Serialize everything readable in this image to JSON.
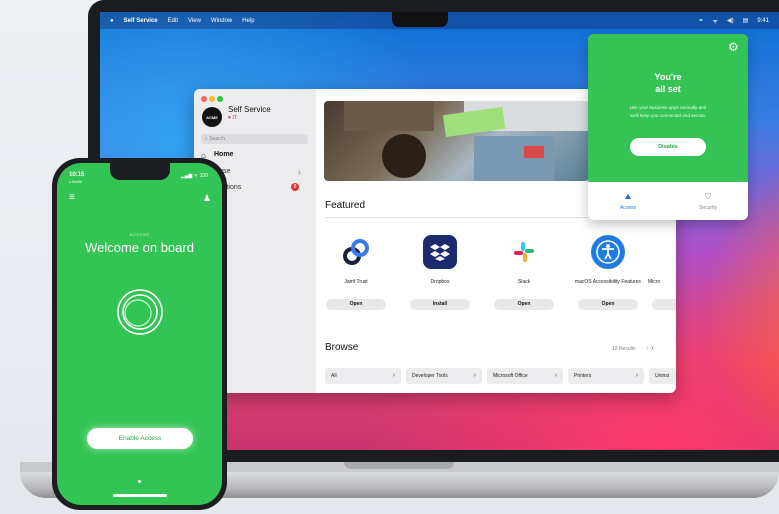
{
  "menubar": {
    "apple": "",
    "app_name": "Self Service",
    "menus": [
      "Edit",
      "View",
      "Window",
      "Help"
    ],
    "clock": "9:41"
  },
  "self_service": {
    "logo_text": "ACME",
    "title": "Self Service",
    "subtitle": "♥ IT",
    "search_placeholder": "Search",
    "nav": {
      "home": "Home",
      "browse": "owse",
      "notifications": "ifications",
      "notifications_badge": "8",
      "history": "tory"
    },
    "featured_title": "Featured",
    "apps": [
      {
        "name": "Jamf Trust",
        "button": "Open",
        "icon": "jamf-trust-icon"
      },
      {
        "name": "Dropbox",
        "button": "Install",
        "icon": "dropbox-icon"
      },
      {
        "name": "Slack",
        "button": "Open",
        "icon": "slack-icon"
      },
      {
        "name": "macOS Accessibility Features",
        "button": "Open",
        "icon": "accessibility-icon"
      },
      {
        "name": "Micro",
        "button": "",
        "icon": "microsoft-icon"
      }
    ],
    "browse_title": "Browse",
    "results": "12 Results",
    "categories": [
      "All",
      "Developer Tools",
      "Microsoft Office",
      "Printers",
      "Uninst"
    ]
  },
  "popover": {
    "title_line1": "You're",
    "title_line2": "all set",
    "description": "Use your business apps normally and we'll keep you connected and secure.",
    "disable_label": "Disable",
    "tabs": [
      {
        "label": "Access",
        "icon": "access-icon",
        "active": true
      },
      {
        "label": "Security",
        "icon": "shield-icon",
        "active": false
      }
    ],
    "accent": "#36c356"
  },
  "phone": {
    "time": "10:15",
    "time_sub": "◂ Mobile",
    "status": "▂▄▆ ᯤ 100",
    "section": "ACCESS",
    "welcome": "Welcome on board",
    "enable_label": "Enable Access",
    "accent": "#32c454"
  }
}
